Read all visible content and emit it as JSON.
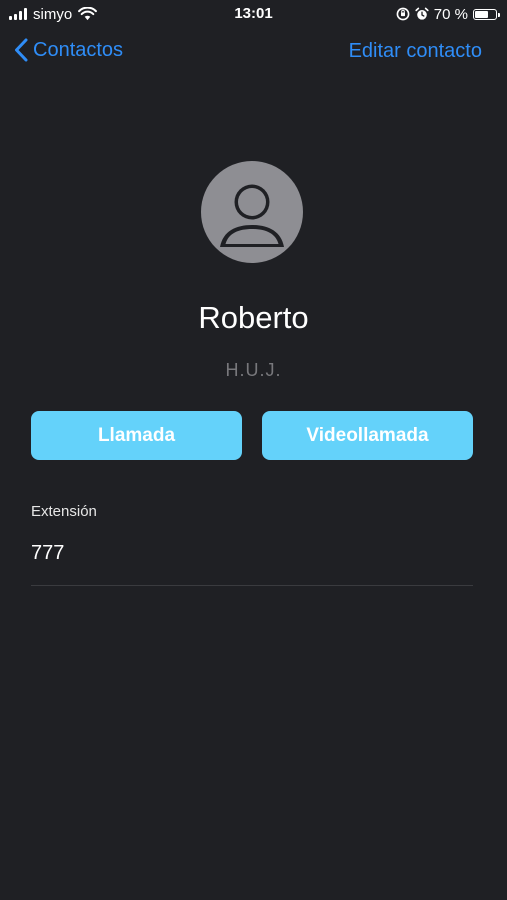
{
  "status_bar": {
    "carrier": "simyo",
    "time": "13:01",
    "battery_percent": "70 %",
    "battery_level": 0.7,
    "icons": [
      "signal-icon",
      "wifi-icon",
      "orientation-lock-icon",
      "alarm-icon",
      "battery-icon"
    ]
  },
  "nav": {
    "back_label": "Contactos",
    "edit_label": "Editar contacto",
    "accent_color": "#2f8df7"
  },
  "contact": {
    "name": "Roberto",
    "initials": "H.U.J.",
    "avatar_icon": "person-placeholder-icon"
  },
  "actions": {
    "call_label": "Llamada",
    "video_label": "Videollamada",
    "button_color": "#64d2fa"
  },
  "fields": [
    {
      "label": "Extensión",
      "value": "777"
    }
  ],
  "colors": {
    "background": "#1f2024"
  }
}
